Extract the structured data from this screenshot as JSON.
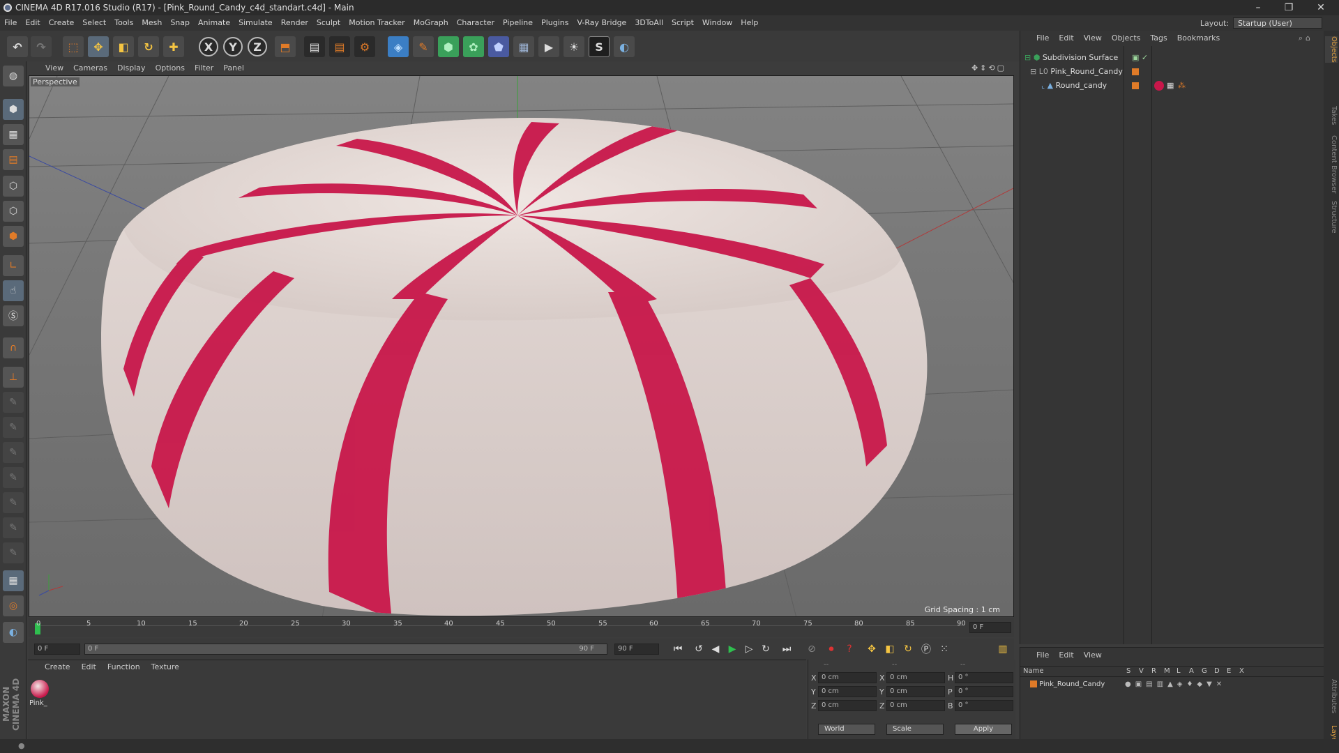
{
  "window": {
    "title": "CINEMA 4D R17.016 Studio (R17) - [Pink_Round_Candy_c4d_standart.c4d] - Main"
  },
  "menu": [
    "File",
    "Edit",
    "Create",
    "Select",
    "Tools",
    "Mesh",
    "Snap",
    "Animate",
    "Simulate",
    "Render",
    "Sculpt",
    "Motion Tracker",
    "MoGraph",
    "Character",
    "Pipeline",
    "Plugins",
    "V-Ray Bridge",
    "3DToAll",
    "Script",
    "Window",
    "Help"
  ],
  "layout": {
    "label": "Layout:",
    "value": "Startup (User)"
  },
  "viewport": {
    "menu": [
      "View",
      "Cameras",
      "Display",
      "Options",
      "Filter",
      "Panel"
    ],
    "label": "Perspective",
    "grid_spacing": "Grid Spacing : 1 cm"
  },
  "timeline": {
    "ticks": [
      "0",
      "5",
      "10",
      "15",
      "20",
      "25",
      "30",
      "35",
      "40",
      "45",
      "50",
      "55",
      "60",
      "65",
      "70",
      "75",
      "80",
      "85",
      "90"
    ],
    "current_frame": "0 F",
    "start_frame": "0 F",
    "range_start": "0 F",
    "range_end": "90 F",
    "end_frame": "90 F"
  },
  "material_panel": {
    "menu": [
      "Create",
      "Edit",
      "Function",
      "Texture"
    ],
    "material_name": "Pink_"
  },
  "coords": {
    "header": [
      "--",
      "--",
      "--"
    ],
    "rows": [
      {
        "a": "X",
        "av": "0 cm",
        "b": "X",
        "bv": "0 cm",
        "c": "H",
        "cv": "0 °"
      },
      {
        "a": "Y",
        "av": "0 cm",
        "b": "Y",
        "bv": "0 cm",
        "c": "P",
        "cv": "0 °"
      },
      {
        "a": "Z",
        "av": "0 cm",
        "b": "Z",
        "bv": "0 cm",
        "c": "B",
        "cv": "0 °"
      }
    ],
    "world": "World",
    "scale": "Scale",
    "apply": "Apply"
  },
  "objects": {
    "menu": [
      "File",
      "Edit",
      "View",
      "Objects",
      "Tags",
      "Bookmarks"
    ],
    "items": [
      "Subdivision Surface",
      "Pink_Round_Candy",
      "Round_candy"
    ]
  },
  "layers": {
    "menu": [
      "File",
      "Edit",
      "View"
    ],
    "columns": [
      "Name",
      "S",
      "V",
      "R",
      "M",
      "L",
      "A",
      "G",
      "D",
      "E",
      "X"
    ],
    "item": "Pink_Round_Candy"
  },
  "right_tabs": [
    "Objects",
    "Takes",
    "Content Browser",
    "Structure",
    "Attributes",
    "Layers"
  ],
  "brand": "MAXON CINEMA 4D",
  "colors": {
    "candy_red": "#c8174a",
    "candy_white": "#e8ddd8",
    "accent_orange": "#e07b28"
  }
}
